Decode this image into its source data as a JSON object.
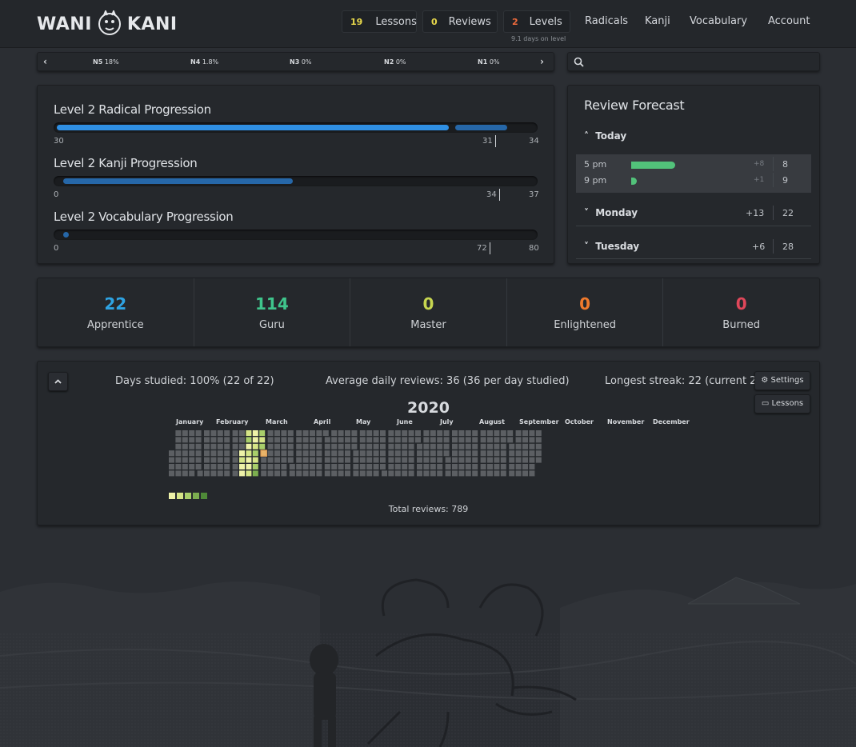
{
  "nav": {
    "logo_left": "WANI",
    "logo_right": "KANI",
    "lessons": {
      "count": "19",
      "label": "Lessons",
      "color": "#e9d94b"
    },
    "reviews": {
      "count": "0",
      "label": "Reviews",
      "color": "#e9d94b"
    },
    "levels": {
      "count": "2",
      "label": "Levels",
      "color": "#f06b3c",
      "sub": "9.1 days on level"
    },
    "radicals": "Radicals",
    "kanji": "Kanji",
    "vocabulary": "Vocabulary",
    "account": "Account"
  },
  "jlpt": [
    {
      "level": "N5",
      "pct": "18%"
    },
    {
      "level": "N4",
      "pct": "1.8%"
    },
    {
      "level": "N3",
      "pct": "0%"
    },
    {
      "level": "N2",
      "pct": "0%"
    },
    {
      "level": "N1",
      "pct": "0%"
    }
  ],
  "progression": [
    {
      "title": "Level 2 Radical Progression",
      "min": "30",
      "mark": "31",
      "max": "34",
      "passed_fraction": 0.82,
      "inprogress_fraction": 0.11,
      "color_passed": "#2f8fe3",
      "color_prog": "#2667a8"
    },
    {
      "title": "Level 2 Kanji Progression",
      "min": "0",
      "mark": "34",
      "max": "37",
      "passed_fraction": 0.0,
      "inprogress_fraction": 0.48,
      "color_passed": "#2f8fe3",
      "color_prog": "#2667a8"
    },
    {
      "title": "Level 2 Vocabulary Progression",
      "min": "0",
      "mark": "72",
      "max": "80",
      "passed_fraction": 0.0,
      "inprogress_fraction": 0.012,
      "color_passed": "#2f8fe3",
      "color_prog": "#2667a8"
    }
  ],
  "forecast": {
    "title": "Review Forecast",
    "today": {
      "label": "Today",
      "rows": [
        {
          "time": "5 pm",
          "plus": "+8",
          "total": "8",
          "fraction": 1.0
        },
        {
          "time": "9 pm",
          "plus": "+1",
          "total": "9",
          "fraction": 0.12
        }
      ]
    },
    "days": [
      {
        "label": "Monday",
        "plus": "+13",
        "total": "22"
      },
      {
        "label": "Tuesday",
        "plus": "+6",
        "total": "28"
      }
    ],
    "bar_color": "#52c27a"
  },
  "stages": [
    {
      "count": "22",
      "label": "Apprentice",
      "color": "#2ea3e3"
    },
    {
      "count": "114",
      "label": "Guru",
      "color": "#3fc58c"
    },
    {
      "count": "0",
      "label": "Master",
      "color": "#c7d650"
    },
    {
      "count": "0",
      "label": "Enlightened",
      "color": "#f07a2c"
    },
    {
      "count": "0",
      "label": "Burned",
      "color": "#e0475a"
    }
  ],
  "heatmap": {
    "days_studied": "Days studied: 100% (22 of 22)",
    "avg_reviews": "Average daily reviews: 36 (36 per day studied)",
    "streak": "Longest streak: 22 (current 22)",
    "settings_label": "⚙ Settings",
    "lessons_label": "▭ Lessons",
    "year": "2020",
    "months": [
      "January",
      "February",
      "March",
      "April",
      "May",
      "June",
      "July",
      "August",
      "September",
      "October",
      "November",
      "December"
    ],
    "total": "Total reviews: 789",
    "colors": {
      "empty": "#5c5f63",
      "c1": "#eef2a8",
      "c2": "#d6e587",
      "c3": "#a9cf6a",
      "c4": "#7cae4f",
      "c5": "#4f8a38",
      "today_border": "#e6a55a"
    }
  }
}
